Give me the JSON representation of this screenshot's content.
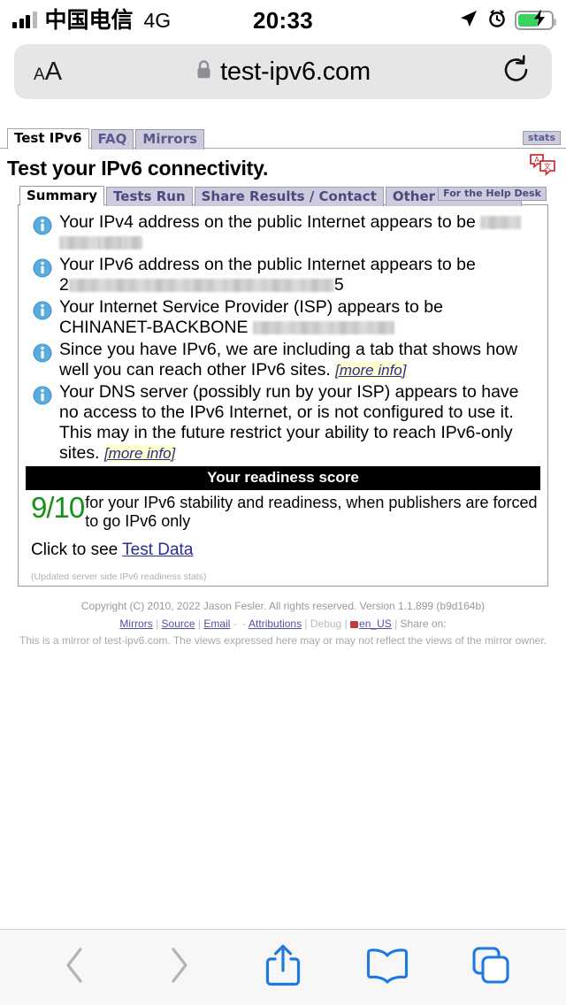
{
  "status_bar": {
    "carrier": "中国电信",
    "network": "4G",
    "time": "20:33",
    "icons": [
      "location-arrow-icon",
      "alarm-clock-icon",
      "battery-charging-icon"
    ],
    "battery_color": "#3ad25f"
  },
  "url_bar": {
    "text_size_label_small": "A",
    "text_size_label_large": "A",
    "url": "test-ipv6.com",
    "lock": "lock-icon",
    "reload": "reload-icon"
  },
  "site": {
    "top_tabs": [
      {
        "label": "Test IPv6",
        "active": true
      },
      {
        "label": "FAQ",
        "active": false
      },
      {
        "label": "Mirrors",
        "active": false
      }
    ],
    "stats_button": "stats",
    "page_title": "Test your IPv6 connectivity.",
    "inner_tabs": [
      {
        "label": "Summary",
        "active": true
      },
      {
        "label": "Tests Run",
        "active": false
      },
      {
        "label": "Share Results / Contact",
        "active": false
      },
      {
        "label": "Other IPv6 Sites",
        "active": false
      }
    ],
    "help_desk_button": "For the Help Desk",
    "results": [
      {
        "id": "ipv4-address",
        "prefix": "Your IPv4 address on the public Internet appears to be ",
        "redacted": true,
        "suffix": ""
      },
      {
        "id": "ipv6-address",
        "prefix": "Your IPv6 address on the public Internet appears to be ",
        "value_start": "2",
        "redacted": true,
        "value_end": "5"
      },
      {
        "id": "isp",
        "prefix": "Your Internet Service Provider (ISP) appears to be CHINANET-BACKBONE ",
        "redacted": true,
        "suffix": ""
      },
      {
        "id": "ipv6-tab-note",
        "prefix": "Since you have IPv6, we are including a tab that shows how well you can reach other IPv6 sites. ",
        "link": "[more info]"
      },
      {
        "id": "dns-note",
        "prefix": "Your DNS server (possibly run by your ISP) appears to have no access to the IPv6 Internet, or is not configured to use it. This may in the future restrict your ability to reach IPv6-only sites. ",
        "link": "[more info]"
      }
    ],
    "score": {
      "header": "Your readiness score",
      "value": "9/10",
      "value_color": "#169016",
      "description": "for your IPv6 stability and readiness, when publishers are forced to go IPv6 only"
    },
    "test_data": {
      "prefix": "Click to see ",
      "link": "Test Data"
    },
    "updated_note": "(Updated server side IPv6 readiness stats)",
    "footer": {
      "copyright": "Copyright (C) 2010, 2022 Jason Fesler. All rights reserved. Version 1.1.899 (b9d164b)",
      "links": [
        "Mirrors",
        "Source",
        "Email",
        "Attributions",
        "Debug",
        "en_US"
      ],
      "share_label": "Share on:",
      "mirror_note": "This is a mirror of test-ipv6.com. The views expressed here may or may not reflect the views of the mirror owner."
    }
  },
  "bottom_toolbar": {
    "buttons": [
      {
        "name": "back-button",
        "icon": "chevron-left-icon",
        "enabled": false
      },
      {
        "name": "forward-button",
        "icon": "chevron-right-icon",
        "enabled": false
      },
      {
        "name": "share-button",
        "icon": "share-icon",
        "enabled": true
      },
      {
        "name": "bookmarks-button",
        "icon": "book-icon",
        "enabled": true
      },
      {
        "name": "tabs-button",
        "icon": "tabs-icon",
        "enabled": true
      }
    ],
    "accent_color": "#1f7ae0"
  }
}
